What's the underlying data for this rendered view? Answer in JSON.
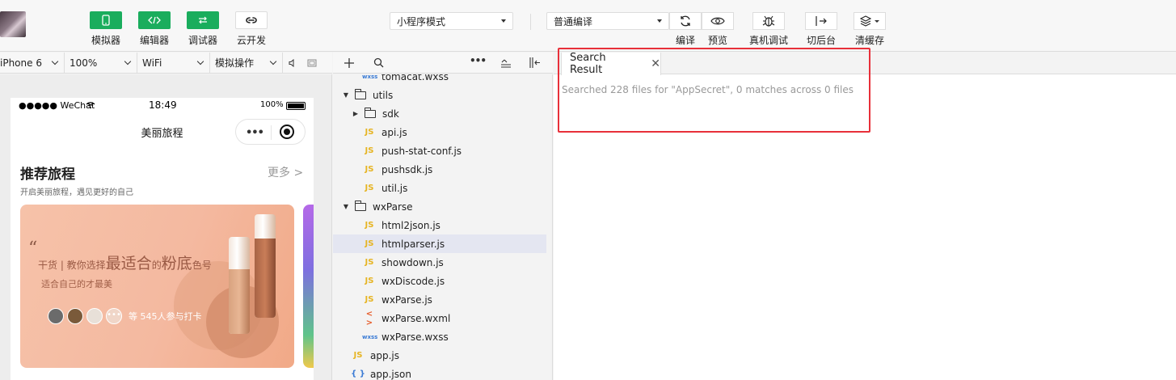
{
  "toolbar": {
    "buttons": [
      {
        "label": "模拟器",
        "icon": "phone-icon"
      },
      {
        "label": "编辑器",
        "icon": "code-icon"
      },
      {
        "label": "调试器",
        "icon": "debug-arrows-icon"
      },
      {
        "label": "云开发",
        "icon": "cloud-link-icon"
      }
    ],
    "mode_select": "小程序模式",
    "compile_select": "普通编译",
    "actions": [
      {
        "label": "编译",
        "icon": "refresh-icon"
      },
      {
        "label": "预览",
        "icon": "eye-icon"
      },
      {
        "label": "真机调试",
        "icon": "bug-icon"
      },
      {
        "label": "切后台",
        "icon": "switch-background-icon"
      },
      {
        "label": "清缓存",
        "icon": "layers-icon"
      }
    ]
  },
  "simulator_bar": {
    "device": "iPhone 6",
    "zoom": "100%",
    "network": "WiFi",
    "operation": "模拟操作"
  },
  "phone": {
    "status_left": "●●●●● WeChat",
    "status_time": "18:49",
    "status_battery": "100%",
    "nav_title": "美丽旅程",
    "section_title": "推荐旅程",
    "more": "更多 >",
    "section_sub": "开启美丽旅程，遇见更好的自己",
    "card": {
      "quote": "“",
      "title_prefix": "干货 | 教你选择",
      "title_big1": "最适合",
      "title_mid": "的",
      "title_big2": "粉底",
      "title_suffix": "色号",
      "subtitle": "适合自己的才最美",
      "participants": "等 545人参与打卡"
    }
  },
  "filetree": {
    "rows": [
      {
        "type": "file",
        "icon": "wxss",
        "name": "tomacat.wxss",
        "indent": 2
      },
      {
        "type": "folder",
        "open": true,
        "name": "utils",
        "indent": 0
      },
      {
        "type": "folder",
        "open": false,
        "name": "sdk",
        "indent": 1
      },
      {
        "type": "file",
        "icon": "js",
        "name": "api.js",
        "indent": 2
      },
      {
        "type": "file",
        "icon": "js",
        "name": "push-stat-conf.js",
        "indent": 2
      },
      {
        "type": "file",
        "icon": "js",
        "name": "pushsdk.js",
        "indent": 2
      },
      {
        "type": "file",
        "icon": "js",
        "name": "util.js",
        "indent": 2
      },
      {
        "type": "folder",
        "open": true,
        "name": "wxParse",
        "indent": 0
      },
      {
        "type": "file",
        "icon": "js",
        "name": "html2json.js",
        "indent": 2
      },
      {
        "type": "file",
        "icon": "js",
        "name": "htmlparser.js",
        "indent": 2,
        "selected": true
      },
      {
        "type": "file",
        "icon": "js",
        "name": "showdown.js",
        "indent": 2
      },
      {
        "type": "file",
        "icon": "js",
        "name": "wxDiscode.js",
        "indent": 2
      },
      {
        "type": "file",
        "icon": "js",
        "name": "wxParse.js",
        "indent": 2
      },
      {
        "type": "file",
        "icon": "wxml",
        "name": "wxParse.wxml",
        "indent": 2
      },
      {
        "type": "file",
        "icon": "wxss",
        "name": "wxParse.wxss",
        "indent": 2
      },
      {
        "type": "file",
        "icon": "js",
        "name": "app.js",
        "indent": 1
      },
      {
        "type": "file",
        "icon": "json",
        "name": "app.json",
        "indent": 1
      }
    ],
    "icon_glyphs": {
      "js": "JS",
      "wxml": "< >",
      "wxss": "wxss",
      "json": "{ }"
    }
  },
  "editor": {
    "tab_label": "Search Result",
    "message": "Searched 228 files for \"AppSecret\", 0 matches across 0 files"
  },
  "colors": {
    "accent_green": "#1aad5d",
    "highlight_red": "#e8303a"
  }
}
